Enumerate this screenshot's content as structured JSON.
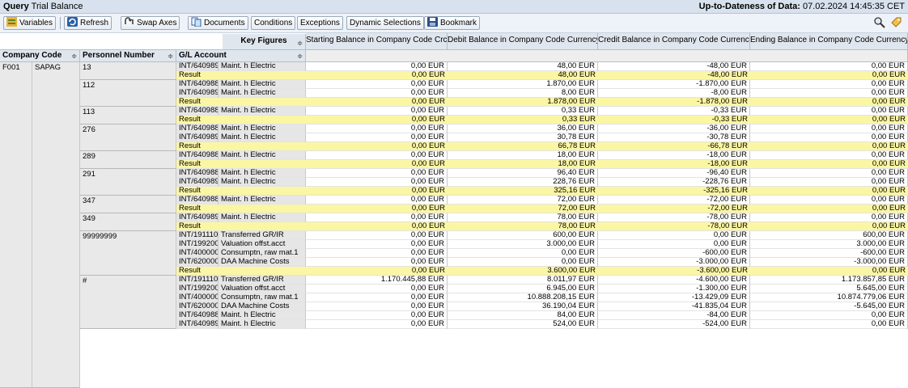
{
  "header": {
    "query_label": "Query",
    "query_name": "Trial Balance",
    "uptodate_label": "Up-to-Dateness of Data:",
    "uptodate_value": "07.02.2024 14:45:35 CET"
  },
  "toolbar": {
    "variables": "Variables",
    "refresh": "Refresh",
    "swap_axes": "Swap Axes",
    "documents": "Documents",
    "conditions": "Conditions",
    "exceptions": "Exceptions",
    "dynamic_selections": "Dynamic Selections",
    "bookmark": "Bookmark"
  },
  "columns": {
    "key_figures": "Key Figures",
    "company_code": "Company Code",
    "personnel_number": "Personnel Number",
    "gl_account": "G/L Account",
    "starting_balance": "Starting Balance in Company Code Crcy",
    "debit_balance": "Debit Balance in Company Code Currency",
    "credit_balance": "Credit Balance in Company Code Currency",
    "ending_balance": "Ending Balance in Company Code Currency"
  },
  "company": {
    "code": "F001",
    "name": "SAPAG"
  },
  "groups": [
    {
      "personnel": "13",
      "rows": [
        {
          "account": "INT/640989",
          "desc": "Maint. h Electric",
          "start": "0,00 EUR",
          "debit": "48,00 EUR",
          "credit": "-48,00 EUR",
          "end": "0,00 EUR"
        },
        {
          "account": "Result",
          "desc": "",
          "start": "0,00 EUR",
          "debit": "48,00 EUR",
          "credit": "-48,00 EUR",
          "end": "0,00 EUR",
          "result": true
        }
      ]
    },
    {
      "personnel": "112",
      "rows": [
        {
          "account": "INT/640988",
          "desc": "Maint. h Electric",
          "start": "0,00 EUR",
          "debit": "1.870,00 EUR",
          "credit": "-1.870,00 EUR",
          "end": "0,00 EUR"
        },
        {
          "account": "INT/640989",
          "desc": "Maint. h Electric",
          "start": "0,00 EUR",
          "debit": "8,00 EUR",
          "credit": "-8,00 EUR",
          "end": "0,00 EUR"
        },
        {
          "account": "Result",
          "desc": "",
          "start": "0,00 EUR",
          "debit": "1.878,00 EUR",
          "credit": "-1.878,00 EUR",
          "end": "0,00 EUR",
          "result": true
        }
      ]
    },
    {
      "personnel": "113",
      "rows": [
        {
          "account": "INT/640988",
          "desc": "Maint. h Electric",
          "start": "0,00 EUR",
          "debit": "0,33 EUR",
          "credit": "-0,33 EUR",
          "end": "0,00 EUR"
        },
        {
          "account": "Result",
          "desc": "",
          "start": "0,00 EUR",
          "debit": "0,33 EUR",
          "credit": "-0,33 EUR",
          "end": "0,00 EUR",
          "result": true
        }
      ]
    },
    {
      "personnel": "276",
      "rows": [
        {
          "account": "INT/640988",
          "desc": "Maint. h Electric",
          "start": "0,00 EUR",
          "debit": "36,00 EUR",
          "credit": "-36,00 EUR",
          "end": "0,00 EUR"
        },
        {
          "account": "INT/640989",
          "desc": "Maint. h Electric",
          "start": "0,00 EUR",
          "debit": "30,78 EUR",
          "credit": "-30,78 EUR",
          "end": "0,00 EUR"
        },
        {
          "account": "Result",
          "desc": "",
          "start": "0,00 EUR",
          "debit": "66,78 EUR",
          "credit": "-66,78 EUR",
          "end": "0,00 EUR",
          "result": true
        }
      ]
    },
    {
      "personnel": "289",
      "rows": [
        {
          "account": "INT/640988",
          "desc": "Maint. h Electric",
          "start": "0,00 EUR",
          "debit": "18,00 EUR",
          "credit": "-18,00 EUR",
          "end": "0,00 EUR"
        },
        {
          "account": "Result",
          "desc": "",
          "start": "0,00 EUR",
          "debit": "18,00 EUR",
          "credit": "-18,00 EUR",
          "end": "0,00 EUR",
          "result": true
        }
      ]
    },
    {
      "personnel": "291",
      "rows": [
        {
          "account": "INT/640988",
          "desc": "Maint. h Electric",
          "start": "0,00 EUR",
          "debit": "96,40 EUR",
          "credit": "-96,40 EUR",
          "end": "0,00 EUR"
        },
        {
          "account": "INT/640989",
          "desc": "Maint. h Electric",
          "start": "0,00 EUR",
          "debit": "228,76 EUR",
          "credit": "-228,76 EUR",
          "end": "0,00 EUR"
        },
        {
          "account": "Result",
          "desc": "",
          "start": "0,00 EUR",
          "debit": "325,16 EUR",
          "credit": "-325,16 EUR",
          "end": "0,00 EUR",
          "result": true
        }
      ]
    },
    {
      "personnel": "347",
      "rows": [
        {
          "account": "INT/640988",
          "desc": "Maint. h Electric",
          "start": "0,00 EUR",
          "debit": "72,00 EUR",
          "credit": "-72,00 EUR",
          "end": "0,00 EUR"
        },
        {
          "account": "Result",
          "desc": "",
          "start": "0,00 EUR",
          "debit": "72,00 EUR",
          "credit": "-72,00 EUR",
          "end": "0,00 EUR",
          "result": true
        }
      ]
    },
    {
      "personnel": "349",
      "rows": [
        {
          "account": "INT/640989",
          "desc": "Maint. h Electric",
          "start": "0,00 EUR",
          "debit": "78,00 EUR",
          "credit": "-78,00 EUR",
          "end": "0,00 EUR"
        },
        {
          "account": "Result",
          "desc": "",
          "start": "0,00 EUR",
          "debit": "78,00 EUR",
          "credit": "-78,00 EUR",
          "end": "0,00 EUR",
          "result": true
        }
      ]
    },
    {
      "personnel": "99999999",
      "rows": [
        {
          "account": "INT/191110",
          "desc": "Transferred GR/IR",
          "start": "0,00 EUR",
          "debit": "600,00 EUR",
          "credit": "0,00 EUR",
          "end": "600,00 EUR"
        },
        {
          "account": "INT/199200",
          "desc": "Valuation offst.acct",
          "start": "0,00 EUR",
          "debit": "3.000,00 EUR",
          "credit": "0,00 EUR",
          "end": "3.000,00 EUR"
        },
        {
          "account": "INT/400000",
          "desc": "Consumptn, raw mat.1",
          "start": "0,00 EUR",
          "debit": "0,00 EUR",
          "credit": "-600,00 EUR",
          "end": "-600,00 EUR"
        },
        {
          "account": "INT/620000",
          "desc": "DAA Machine Costs",
          "start": "0,00 EUR",
          "debit": "0,00 EUR",
          "credit": "-3.000,00 EUR",
          "end": "-3.000,00 EUR"
        },
        {
          "account": "Result",
          "desc": "",
          "start": "0,00 EUR",
          "debit": "3.600,00 EUR",
          "credit": "-3.600,00 EUR",
          "end": "0,00 EUR",
          "result": true
        }
      ]
    },
    {
      "personnel": "#",
      "rows": [
        {
          "account": "INT/191110",
          "desc": "Transferred GR/IR",
          "start": "1.170.445,88 EUR",
          "debit": "8.011,97 EUR",
          "credit": "-4.600,00 EUR",
          "end": "1.173.857,85 EUR"
        },
        {
          "account": "INT/199200",
          "desc": "Valuation offst.acct",
          "start": "0,00 EUR",
          "debit": "6.945,00 EUR",
          "credit": "-1.300,00 EUR",
          "end": "5.645,00 EUR"
        },
        {
          "account": "INT/400000",
          "desc": "Consumptn, raw mat.1",
          "start": "0,00 EUR",
          "debit": "10.888.208,15 EUR",
          "credit": "-13.429,09 EUR",
          "end": "10.874.779,06 EUR"
        },
        {
          "account": "INT/620000",
          "desc": "DAA Machine Costs",
          "start": "0,00 EUR",
          "debit": "36.190,04 EUR",
          "credit": "-41.835,04 EUR",
          "end": "-5.645,00 EUR"
        },
        {
          "account": "INT/640988",
          "desc": "Maint. h Electric",
          "start": "0,00 EUR",
          "debit": "84,00 EUR",
          "credit": "-84,00 EUR",
          "end": "0,00 EUR"
        },
        {
          "account": "INT/640989",
          "desc": "Maint. h Electric",
          "start": "0,00 EUR",
          "debit": "524,00 EUR",
          "credit": "-524,00 EUR",
          "end": "0,00 EUR"
        }
      ]
    }
  ]
}
